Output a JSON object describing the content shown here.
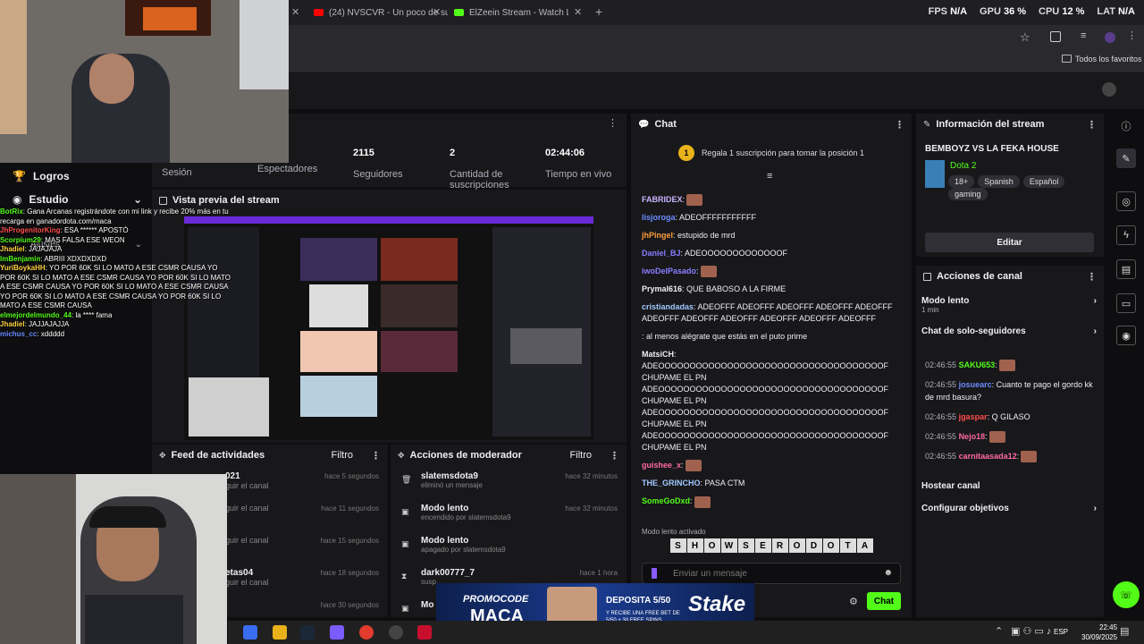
{
  "browser": {
    "tab1": "(24) NVSCVR - Un poco de su",
    "tab2": "ElZeein Stream - Watch Live on",
    "new_tab": "+",
    "bookmarks": "Todos los favoritos"
  },
  "perf": {
    "fps_label": "FPS",
    "fps": "N/A",
    "gpu_label": "GPU",
    "gpu": "36 %",
    "cpu_label": "CPU",
    "cpu": "12 %",
    "lat_label": "LAT",
    "lat": "N/A"
  },
  "overlay": {
    "logros": "Logros",
    "estudio": "Estudio",
    "ajustes": "Ajustes",
    "chat": [
      {
        "u": "BotRix",
        "t": ": Gana Arcanas registrándote con mi link y recibe 20% más en tu recarga en",
        "link": "ganadordota.com/maca"
      },
      {
        "u": "JhProgenitorKing",
        "t": ": ESA ****** APOSTÓ"
      },
      {
        "u": "Scorpium29",
        "t": ": MAS FALSA ESE WEON"
      },
      {
        "u": "Jhadiel",
        "t": ": JAJAJAJA"
      },
      {
        "u": "lmBenjamin",
        "t": ": ABRIII XDXDXDXD"
      },
      {
        "u": "YuriBoykaHH",
        "t": ": YO POR 60K SI LO MATO A ESE CSMR CAUSA YO POR 60K SI LO MATO A ESE CSMR CAUSA YO POR 60K SI LO MATO A ESE CSMR CAUSA YO POR 60K SI LO MATO A ESE CSMR CAUSA YO POR 60K SI LO MATO A ESE CSMR CAUSA YO POR 60K SI LO MATO A ESE CSMR CAUSA"
      },
      {
        "u": "elmejordelmundo_44",
        "t": ": la **** fama"
      },
      {
        "u": "Jhadiel",
        "t": ": JAJJAJAJJA"
      },
      {
        "u": "michus_cc",
        "t": ": xddddd"
      }
    ]
  },
  "stats": {
    "session": "Sesión",
    "viewers_label": "Espectadores",
    "followers": "2115",
    "followers_label": "Seguidores",
    "subs": "2",
    "subs_label": "Cantidad de suscripciones",
    "live": "02:44:06",
    "live_label": "Tiempo en vivo"
  },
  "preview": {
    "title": "Vista previa del stream"
  },
  "feed": {
    "title": "Feed de actividades",
    "filter": "Filtro",
    "items": [
      {
        "n": "021",
        "s": "guir el canal",
        "t": "hace 5 segundos"
      },
      {
        "n": "",
        "s": "guir el canal",
        "t": "hace 11 segundos"
      },
      {
        "n": "",
        "s": "guir el canal",
        "t": "hace 15 segundos"
      },
      {
        "n": "etas04",
        "s": "guir el canal",
        "t": "hace 18 segundos"
      },
      {
        "n": "",
        "s": "",
        "t": "hace 30 segundos"
      }
    ]
  },
  "mod": {
    "title": "Acciones de moderador",
    "filter": "Filtro",
    "items": [
      {
        "n": "slatemsdota9",
        "s": "eliminó un mensaje",
        "t": "hace 32 minutos"
      },
      {
        "n": "Modo lento",
        "s": "encendido por slatemsdota9",
        "t": "hace 32 minutos"
      },
      {
        "n": "Modo lento",
        "s": "apagado por slatemsdota9",
        "t": ""
      },
      {
        "n": "dark00777_7",
        "s": "susp",
        "t": "hace 1 hora"
      },
      {
        "n": "Mo",
        "s": "",
        "t": ""
      }
    ]
  },
  "chat": {
    "title": "Chat",
    "gift": "Regala 1 suscripción para tomar la posición 1",
    "gift_rank": "1",
    "messages": [
      {
        "u": "FABRIDEX",
        "t": ":",
        "c": "#c8b3ff",
        "e": 1
      },
      {
        "u": "lisjoroga",
        "t": ": ADEOFFFFFFFFFFF",
        "c": "#6b8cff",
        "e": 0
      },
      {
        "u": "jhPingel",
        "t": ": estupido de mrd",
        "c": "#ff9d3b",
        "e": 0
      },
      {
        "u": "Daniel_BJ",
        "t": ": ADEOOOOOOOOOOOOOF",
        "c": "#8a7dff",
        "e": 0
      },
      {
        "u": "iwoDelPasado",
        "t": ":",
        "c": "#8a7dff",
        "e": 1
      },
      {
        "u": "Prymal616",
        "t": ": QUE BABOSO A LA FIRME",
        "c": "#efeff1",
        "e": 0
      },
      {
        "u": "cristiandadas",
        "t": ": ADEOFFF ADEOFFF ADEOFFF ADEOFFF ADEOFFF ADEOFFF ADEOFFF ADEOFFF ADEOFFF ADEOFFF ADEOFFF",
        "c": "#9fc8ff",
        "e": 0
      },
      {
        "u": "",
        "t": ": al menos alégrate que estás en el puto prime",
        "c": "#ff4d4d",
        "e": 0
      },
      {
        "u": "MatsiCH",
        "t": ": ADEOOOOOOOOOOOOOOOOOOOOOOOOOOOOOOOOOOOOF CHUPAME EL PN ADEOOOOOOOOOOOOOOOOOOOOOOOOOOOOOOOOOOOOF CHUPAME EL PN ADEOOOOOOOOOOOOOOOOOOOOOOOOOOOOOOOOOOOOF CHUPAME EL PN ADEOOOOOOOOOOOOOOOOOOOOOOOOOOOOOOOOOOOOF CHUPAME EL PN",
        "c": "#efeff1",
        "e": 0
      },
      {
        "u": "guishee_x",
        "t": ":",
        "c": "#ff6b9d",
        "e": 1
      },
      {
        "u": "THE_GRINCHO",
        "t": ": PASA CTM",
        "c": "#9fc8ff",
        "e": 0
      },
      {
        "u": "SomeGoDxd",
        "t": ":",
        "c": "#53fc18",
        "e": 1
      }
    ],
    "slow_mode": "Modo lento activado",
    "placeholder": "Enviar un mensaje",
    "send": "Chat",
    "overlay_text": "SHOWSERODOTA"
  },
  "info": {
    "title": "Información del stream",
    "stream_title": "BEMBOYZ VS LA FEKA HOUSE",
    "category": "Dota 2",
    "tags": [
      "18+",
      "Spanish",
      "Español",
      "gaming"
    ],
    "edit": "Editar"
  },
  "actions": {
    "title": "Acciones de canal",
    "slow": "Modo lento",
    "slow_sub": "1 min",
    "followers_only": "Chat de solo-seguidores",
    "mini_chat": [
      {
        "time": "02:46:55",
        "u": "SAKU653",
        "t": ":",
        "c": "#53fc18",
        "e": 1
      },
      {
        "time": "02:46:55",
        "u": "josuearc",
        "t": ": Cuanto te pago el gordo kk de mrd basura?",
        "c": "#6b8cff",
        "e": 0
      },
      {
        "time": "02:46:55",
        "u": "jgaspar",
        "t": ": Q GILASO",
        "c": "#ff4d4d",
        "e": 0
      },
      {
        "time": "02:46:55",
        "u": "Nejo18",
        "t": ":",
        "c": "#ff6b9d",
        "e": 1
      },
      {
        "time": "02:46:55",
        "u": "carnitaasada12",
        "t": ":",
        "c": "#ff6b9d",
        "e": 1
      }
    ],
    "host": "Hostear canal",
    "goals": "Configurar objetivos"
  },
  "taskbar": {
    "lang": "ESP",
    "time": "22:45",
    "date": "30/09/2025"
  },
  "promo": {
    "line1": "PROMOCODE",
    "code": "MACA",
    "deposit": "DEPOSITA 5/50",
    "sub": "Y RECIBE UNA FREE BET DE 5/50 + 30 FREE SPINS",
    "brand": "Stake"
  },
  "colors": {
    "accent": "#53fc18",
    "bg": "#0e0e10",
    "panel": "#18181b"
  }
}
